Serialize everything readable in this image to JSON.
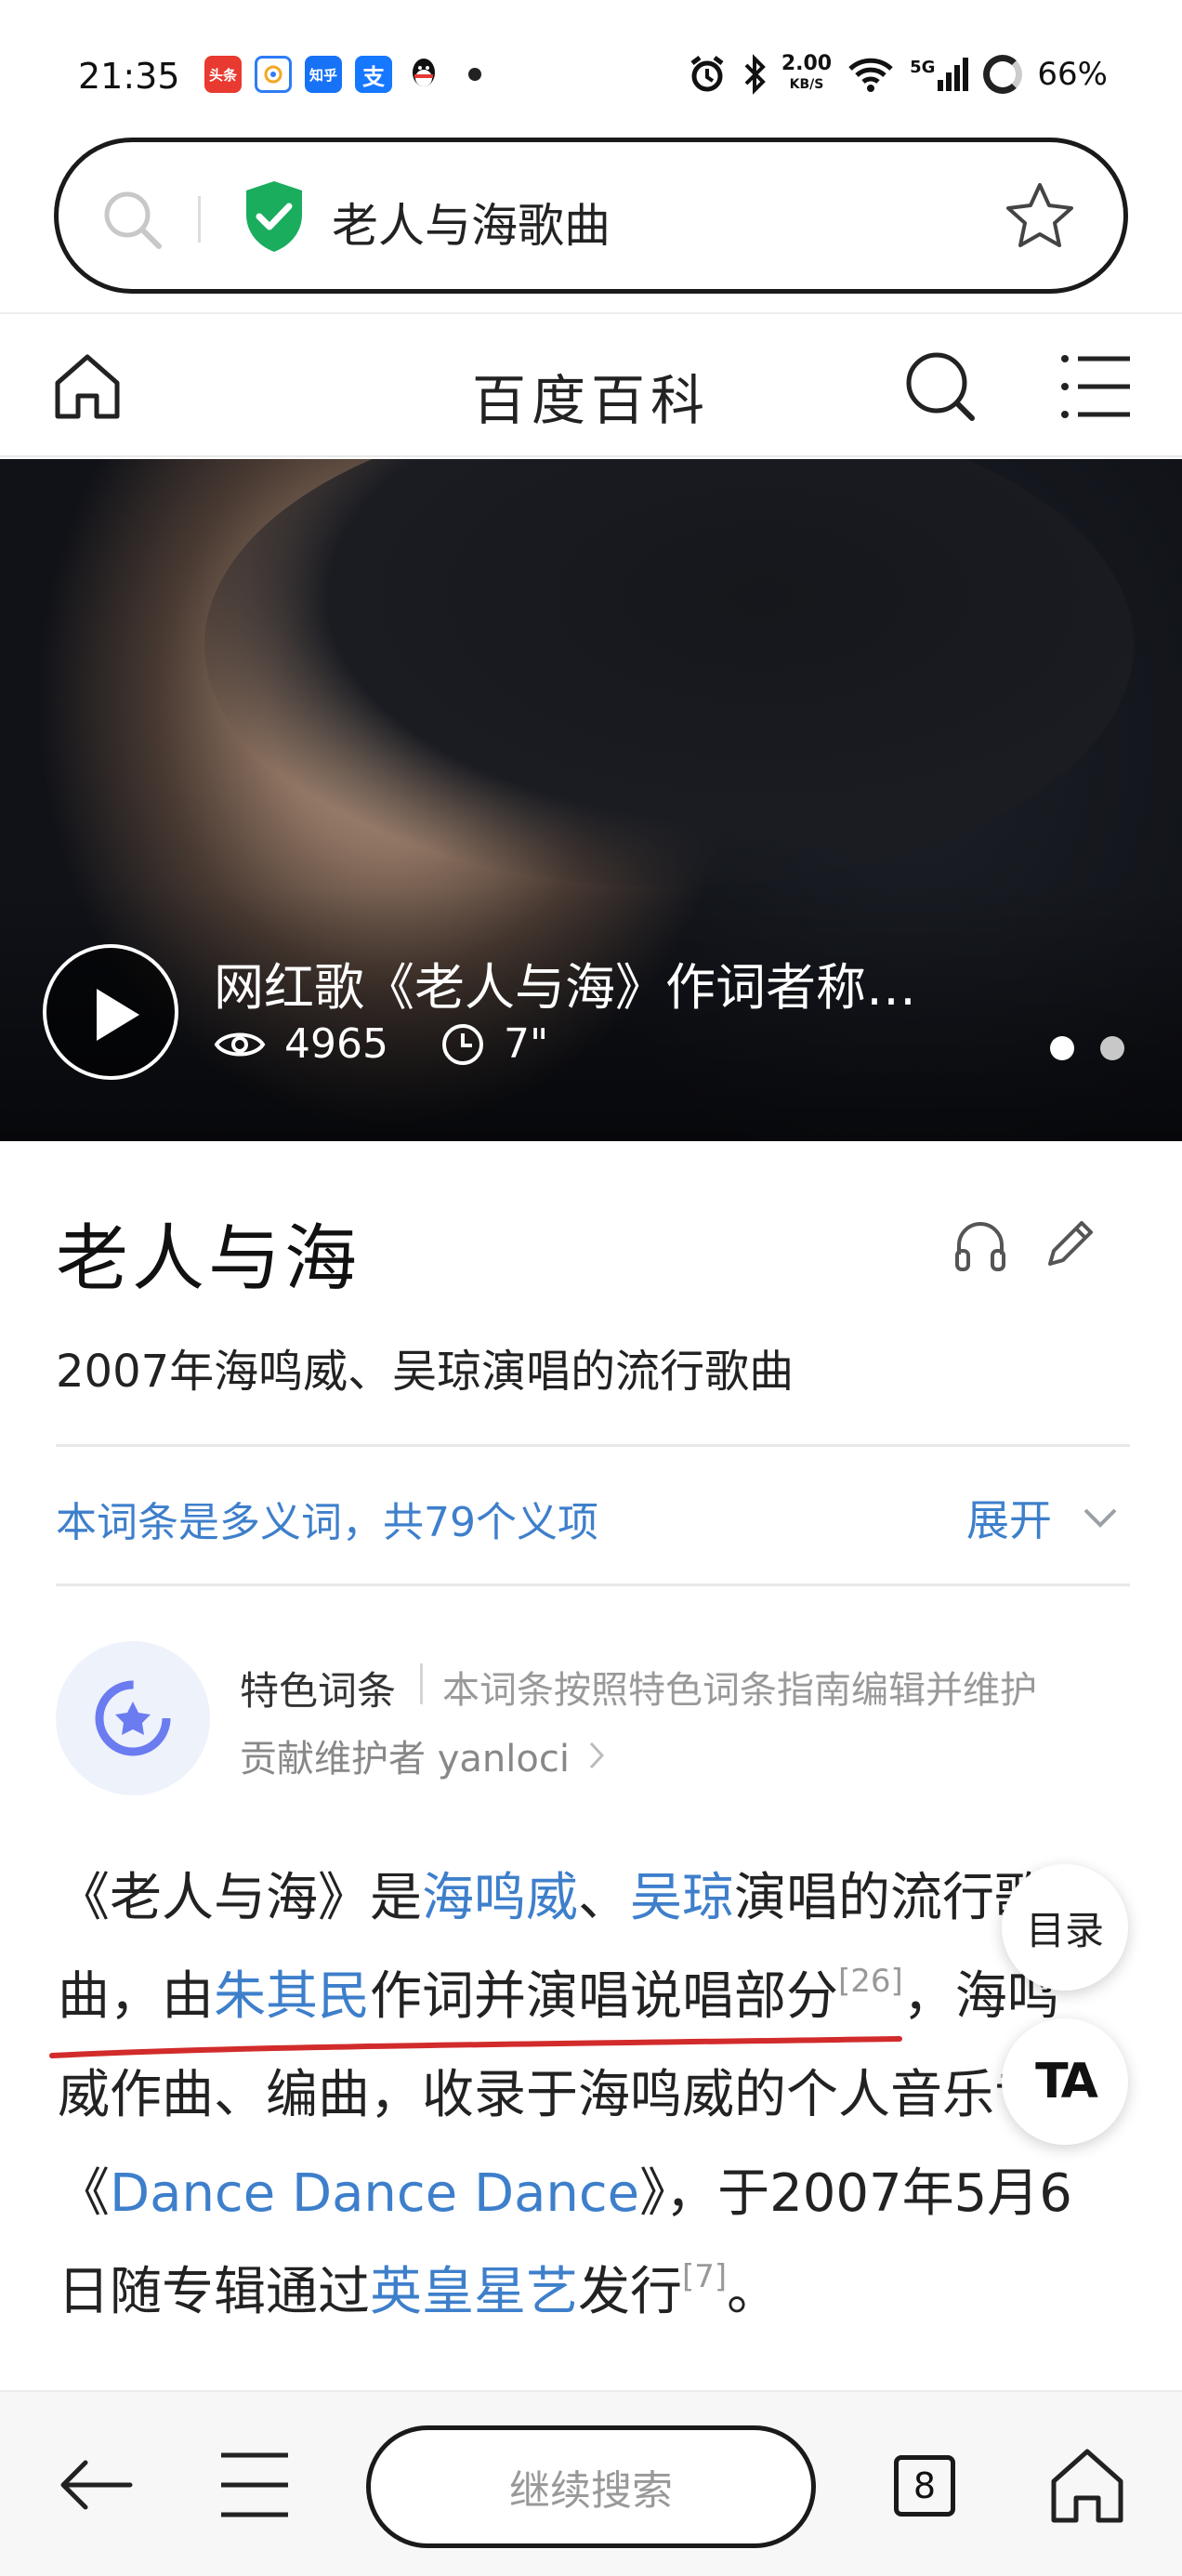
{
  "status_bar": {
    "time": "21:35",
    "apps": [
      {
        "name": "toutiao",
        "label": "头条",
        "color": "#e83a30"
      },
      {
        "name": "qq-browser",
        "label": "",
        "color": "#2f7cf6"
      },
      {
        "name": "zhihu",
        "label": "知乎",
        "color": "#1772f6"
      },
      {
        "name": "alipay",
        "label": "支",
        "color": "#1677ff"
      },
      {
        "name": "qq",
        "label": "",
        "color": "#111111"
      }
    ],
    "net_speed_value": "2.00",
    "net_speed_unit": "KB/S",
    "signal_label": "5G",
    "battery": "66%"
  },
  "search_bar": {
    "query": "老人与海歌曲",
    "secure_color": "#1aad5e"
  },
  "nav": {
    "title": "百度百科"
  },
  "video": {
    "title": "网红歌《老人与海》作词者称…",
    "views": "4965",
    "duration": "7\"",
    "page_count": 2,
    "current_page": 1
  },
  "entry": {
    "title": "老人与海",
    "description": "2007年海鸣威、吴琼演唱的流行歌曲",
    "polysemy_text": "本词条是多义词，共79个义项",
    "expand_label": "展开"
  },
  "featured": {
    "label": "特色词条",
    "note": "本词条按照特色词条指南编辑并维护",
    "contributor": "贡献维护者 yanloci"
  },
  "paragraph": {
    "p1": "《老人与海》是",
    "link1": "海鸣威",
    "p2": "、",
    "link2": "吴琼",
    "p3": "演唱的流行歌曲，由",
    "link3": "朱其民",
    "p4": "作词并演唱说唱部分",
    "ref1": "[26]",
    "p5": "，海鸣威作曲、编曲，收录于海鸣威的个人音乐专辑《",
    "link4": "Dance Dance Dance",
    "p6": "》，于2007年5月6日随专辑通过",
    "link5": "英皇星艺",
    "p7": "发行",
    "ref2": "[7]",
    "p8": "。",
    "link_color": "#3e7fcb",
    "annotation_color": "#d22b2b"
  },
  "floating": {
    "toc_label": "目录",
    "font_label": "TA"
  },
  "bottom_bar": {
    "continue_label": "继续搜索",
    "tab_count": "8"
  }
}
